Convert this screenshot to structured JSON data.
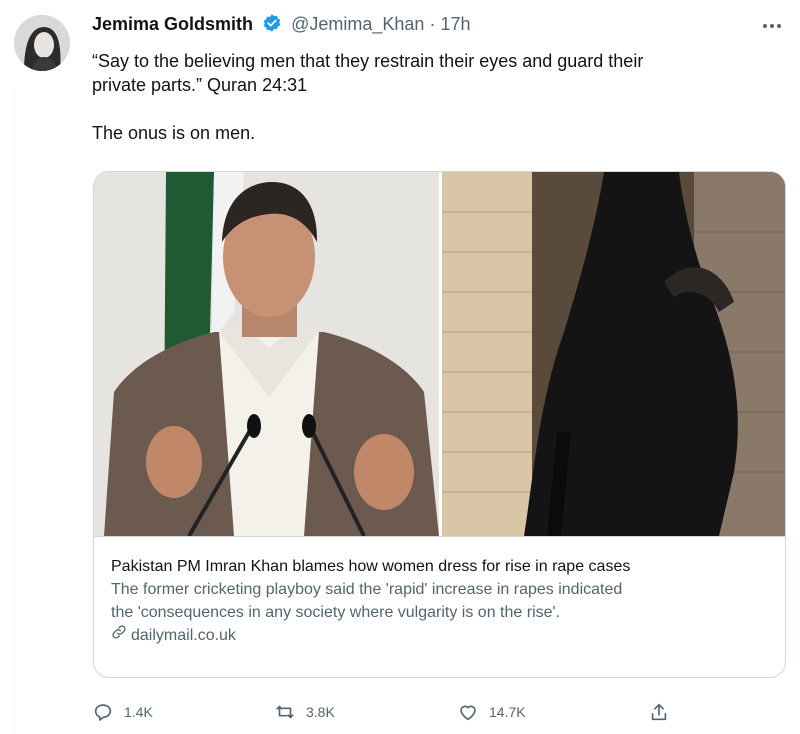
{
  "tweet": {
    "author_name": "Jemima Goldsmith",
    "handle": "@Jemima_Khan",
    "separator": "·",
    "time": "17h",
    "text_lines": [
      "“Say to the believing men that they restrain their eyes and guard their",
      "private parts.” Quran 24:31"
    ],
    "text_line_2": "The onus is on men.",
    "verified_color": "#1d9bf0"
  },
  "card": {
    "title": "Pakistan PM Imran Khan blames how women dress for rise in rape cases",
    "description_lines": [
      "The former cricketing playboy said the 'rapid' increase in rapes indicated",
      "the 'consequences in any society where vulgarity is on the rise'."
    ],
    "domain": "dailymail.co.uk",
    "link_icon": "link-icon"
  },
  "actions": {
    "reply_count": "1.4K",
    "retweet_count": "3.8K",
    "like_count": "14.7K",
    "icons": [
      "reply-icon",
      "retweet-icon",
      "like-icon",
      "share-icon"
    ]
  }
}
